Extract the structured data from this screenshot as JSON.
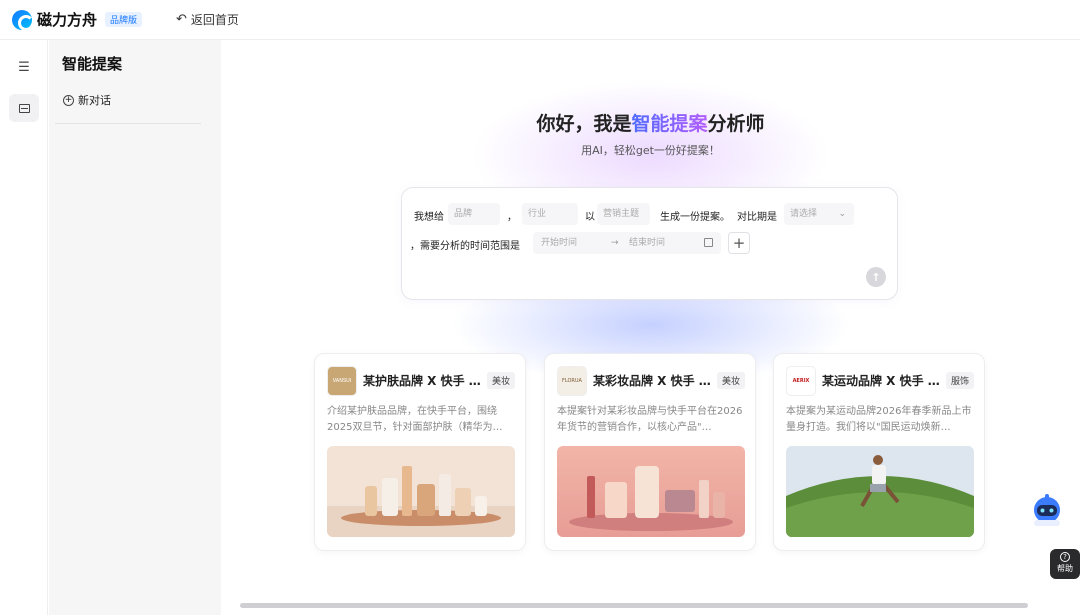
{
  "header": {
    "logo_text": "磁力方舟",
    "edition_badge": "品牌版",
    "back_label": "返回首页"
  },
  "sidebar": {
    "panel_title": "智能提案",
    "new_chat_label": "新对话"
  },
  "hero": {
    "title_prefix": "你好，我是",
    "title_accent": "智能提案",
    "title_suffix": "分析师",
    "subtitle": "用AI，轻松get一份好提案！"
  },
  "prompt": {
    "text_i_want": "我想给",
    "brand_placeholder": "品牌",
    "comma": "，",
    "industry_placeholder": "行业",
    "text_with": "以",
    "theme_placeholder": "营销主题",
    "text_generate": "生成一份提案。",
    "text_compare": "对比期是",
    "compare_placeholder": "请选择",
    "text_time_range": "，需要分析的时间范围是",
    "start_placeholder": "开始时间",
    "end_placeholder": "结束时间",
    "arrow": "→"
  },
  "cards": [
    {
      "title": "某护肤品牌 X 快手 …",
      "tag": "美妆",
      "logo_text": "VANSUI",
      "description": "介绍某护肤品品牌，在快手平台，围绕2025双旦节，针对面部护肤（精华为…"
    },
    {
      "title": "某彩妆品牌 X 快手 …",
      "tag": "美妆",
      "logo_text": "FLORUA",
      "description": "本提案针对某彩妆品牌与快手平台在2026年货节的营销合作，以核心产品\"…"
    },
    {
      "title": "某运动品牌 X 快手 …",
      "tag": "服饰",
      "logo_text": "AERIX",
      "description": "本提案为某运动品牌2026年春季新品上市量身打造。我们将以\"国民运动焕新…"
    }
  ],
  "help": {
    "label": "帮助"
  },
  "colors": {
    "brand_blue": "#1677ff",
    "accent_gradient_start": "#4f6bff",
    "accent_gradient_end": "#b45cff"
  }
}
